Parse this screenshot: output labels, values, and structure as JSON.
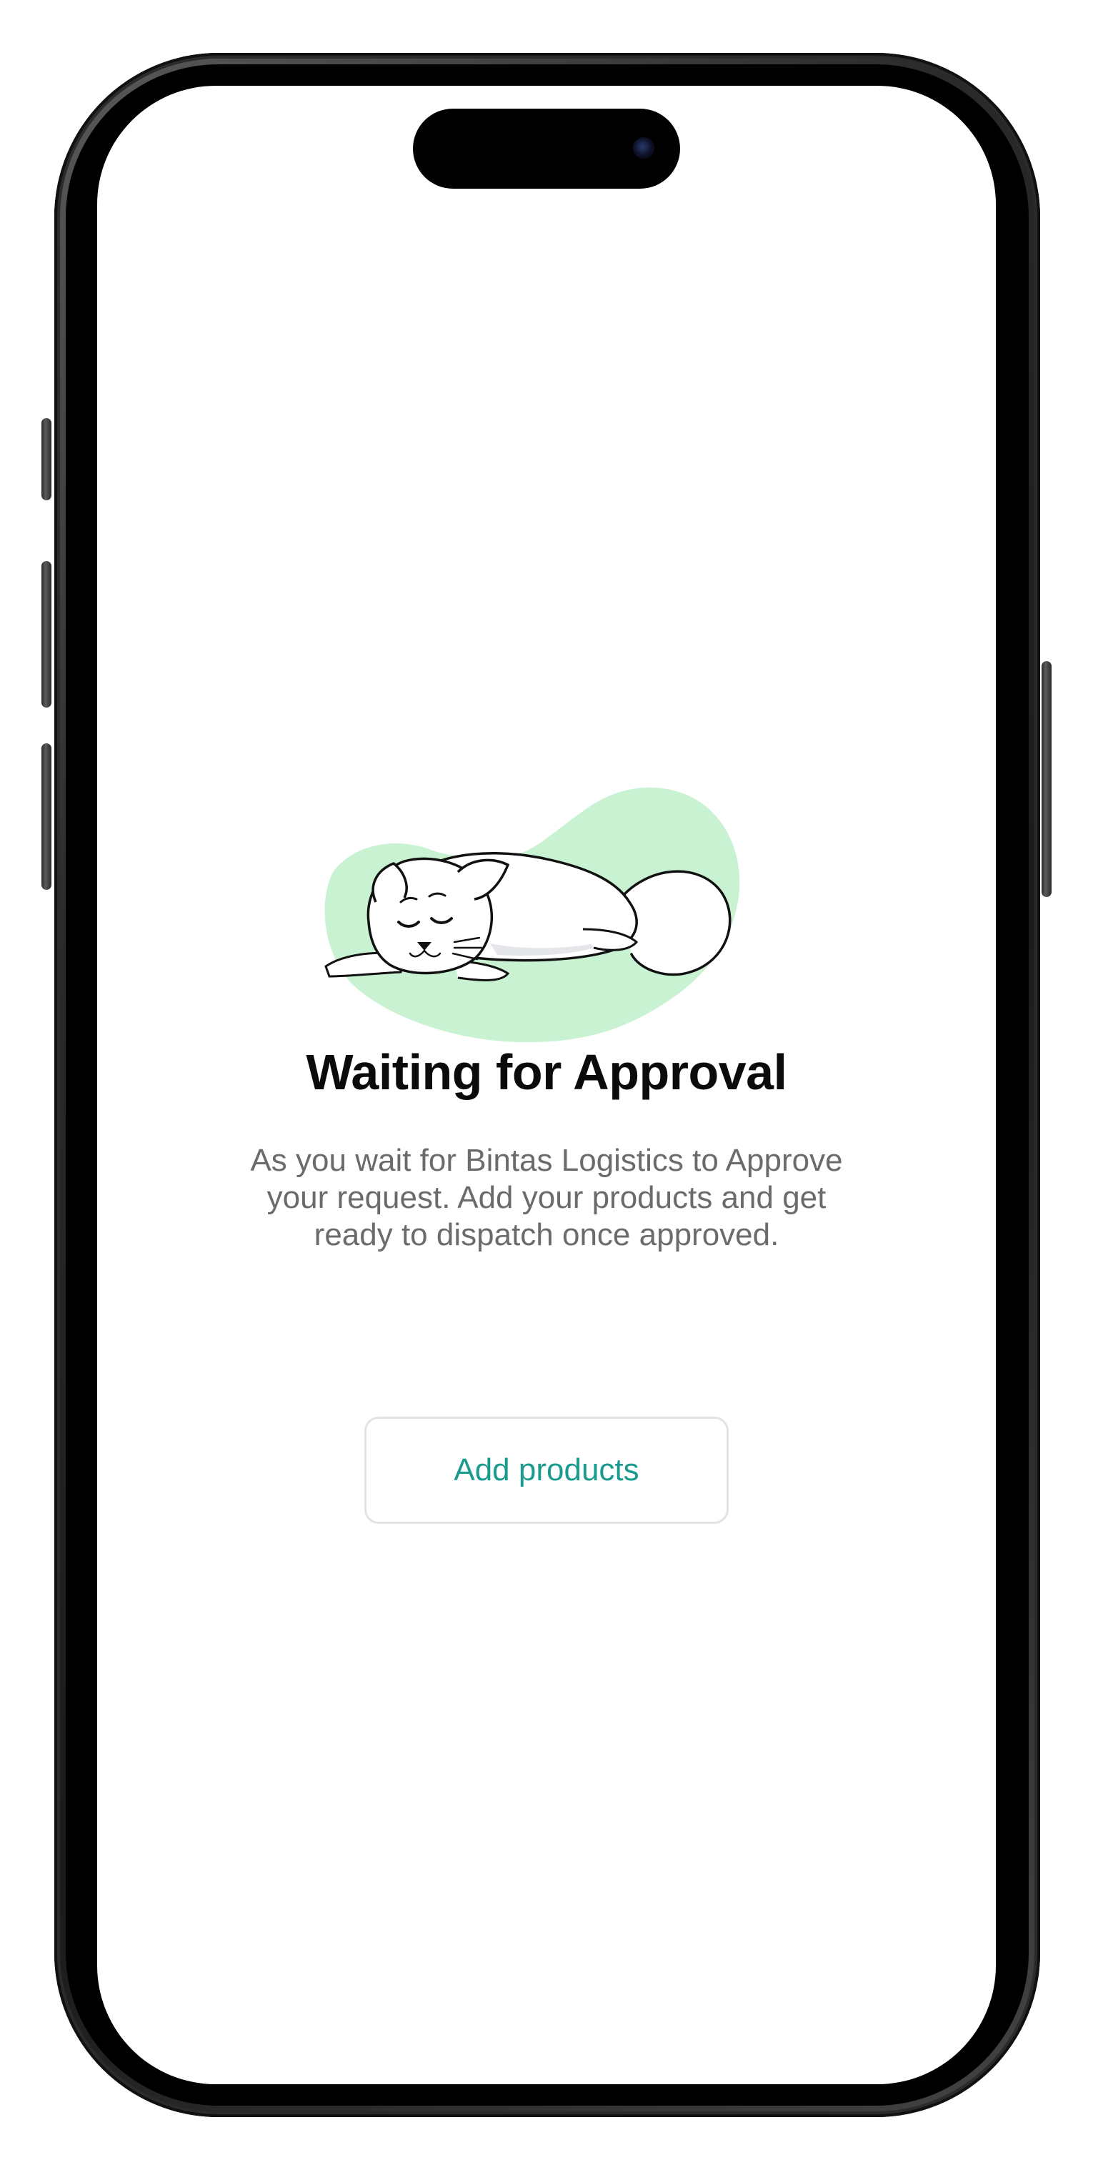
{
  "screen": {
    "title": "Waiting for Approval",
    "description": "As you wait for  Bintas Logistics to Approve\nyour request. Add your products and get\nready to dispatch once approved.",
    "primary_action_label": "Add products",
    "illustration": "sleeping-cat-illustration"
  },
  "colors": {
    "background": "#ffffff",
    "title": "#0b0b0b",
    "body_text": "#6b6b6b",
    "accent": "#1a9b8e",
    "illustration_blob": "#c8f2d2",
    "button_border": "#e3e3e3"
  }
}
